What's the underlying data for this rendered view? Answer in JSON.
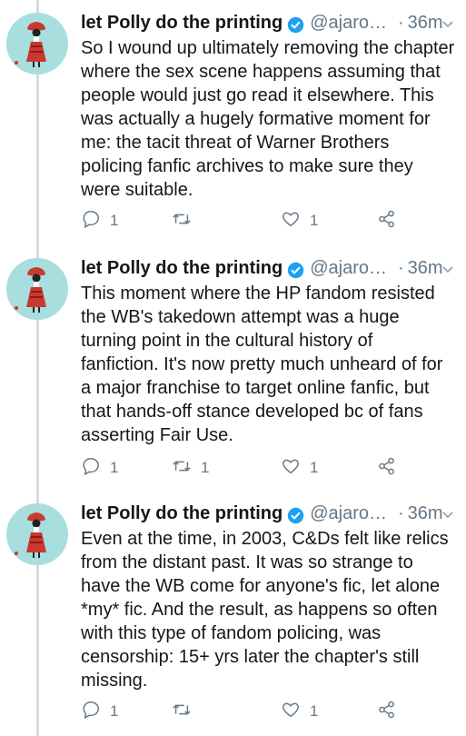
{
  "tweets": [
    {
      "name": "let Polly do the printing",
      "handle": "@ajaro…",
      "dot": "·",
      "time": "36m",
      "text": "So I wound up ultimately removing the chapter where the sex scene happens assuming that people would just go read it elsewhere. This was actually a hugely formative moment for me: the tacit threat of Warner Brothers policing fanfic archives to make sure they were suitable.",
      "replies": "1",
      "retweets": "",
      "likes": "1"
    },
    {
      "name": "let Polly do the printing",
      "handle": "@ajaro…",
      "dot": "·",
      "time": "36m",
      "text": "This moment where the HP fandom resisted the WB's takedown attempt was a huge turning point in the cultural history of fanfiction. It's now pretty much unheard of for a major franchise to target online fanfic, but that hands-off stance developed bc of fans asserting Fair Use.",
      "replies": "1",
      "retweets": "1",
      "likes": "1"
    },
    {
      "name": "let Polly do the printing",
      "handle": "@ajaro…",
      "dot": "·",
      "time": "36m",
      "text": "Even at the time, in 2003, C&Ds felt like relics from the distant past. It was so strange to have the WB come for anyone's fic, let alone *my* fic. And the result, as happens so often with this type of fandom policing, was censorship: 15+ yrs later the chapter's still missing.",
      "replies": "1",
      "retweets": "",
      "likes": "1"
    }
  ],
  "colors": {
    "verified": "#1da1f2",
    "secondary_text": "#657786",
    "avatar_bg": "#a8dedd",
    "thread_line": "#d4dbe1"
  },
  "icons": [
    "verified-badge-icon",
    "chevron-down-icon",
    "reply-icon",
    "retweet-icon",
    "like-icon",
    "share-icon"
  ]
}
